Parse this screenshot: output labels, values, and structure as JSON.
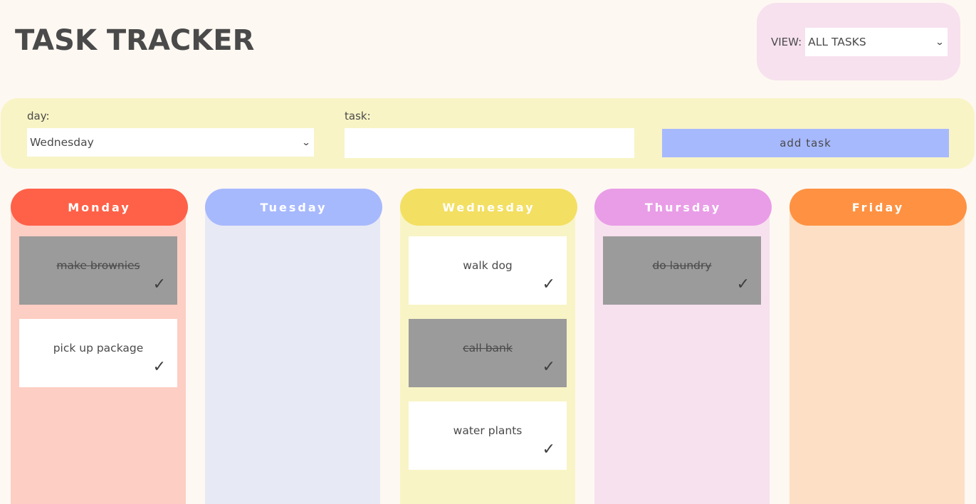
{
  "header": {
    "title": "TASK TRACKER",
    "view_label": "VIEW:",
    "view_selected": "ALL TASKS"
  },
  "form": {
    "day_label": "day:",
    "day_selected": "Wednesday",
    "task_label": "task:",
    "task_value": "",
    "task_placeholder": "",
    "add_button": "add task"
  },
  "icons": {
    "dropdown": "chevron-down-icon",
    "check": "checkmark-icon",
    "check_glyph": "✓",
    "chevron_glyph": "⌄"
  },
  "columns": [
    {
      "day": "Monday",
      "header_color": "#fe6148",
      "body_color": "#fdcec3",
      "tasks": [
        {
          "text": "make brownies",
          "done": true
        },
        {
          "text": "pick up package",
          "done": false
        }
      ]
    },
    {
      "day": "Tuesday",
      "header_color": "#a7b9fd",
      "body_color": "#e7e9f5",
      "tasks": []
    },
    {
      "day": "Wednesday",
      "header_color": "#f3df62",
      "body_color": "#f8f4c5",
      "tasks": [
        {
          "text": "walk dog",
          "done": false
        },
        {
          "text": "call bank",
          "done": true
        },
        {
          "text": "water plants",
          "done": false
        }
      ]
    },
    {
      "day": "Thursday",
      "header_color": "#e99de7",
      "body_color": "#f7e1ee",
      "tasks": [
        {
          "text": "do laundry",
          "done": true
        }
      ]
    },
    {
      "day": "Friday",
      "header_color": "#fe9242",
      "body_color": "#fcdfc4",
      "tasks": []
    }
  ]
}
